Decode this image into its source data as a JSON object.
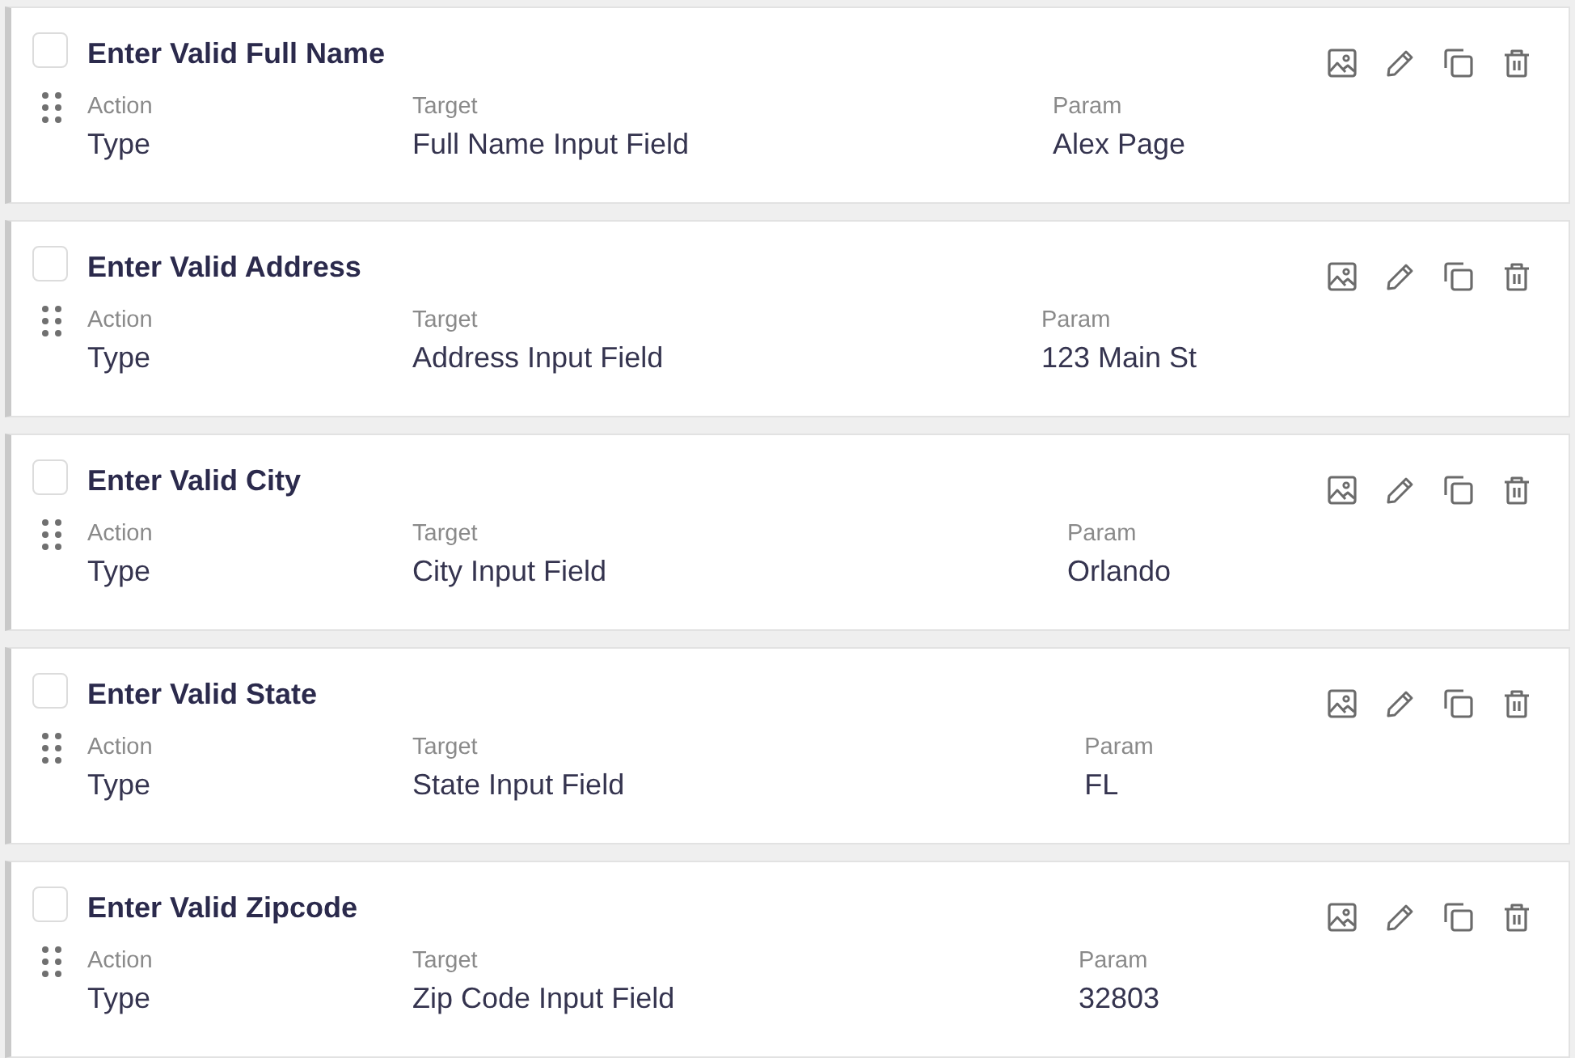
{
  "steps": [
    {
      "title": "Enter Valid Full Name",
      "checked": false,
      "fields": [
        {
          "label": "Action",
          "value": "Type"
        },
        {
          "label": "Target",
          "value": "Full Name Input Field"
        },
        {
          "label": "Param",
          "value": "Alex Page"
        }
      ]
    },
    {
      "title": "Enter Valid Address",
      "checked": false,
      "fields": [
        {
          "label": "Action",
          "value": "Type"
        },
        {
          "label": "Target",
          "value": "Address Input Field"
        },
        {
          "label": "Param",
          "value": "123 Main St"
        }
      ]
    },
    {
      "title": "Enter Valid City",
      "checked": false,
      "fields": [
        {
          "label": "Action",
          "value": "Type"
        },
        {
          "label": "Target",
          "value": "City Input Field"
        },
        {
          "label": "Param",
          "value": "Orlando"
        }
      ]
    },
    {
      "title": "Enter Valid State",
      "checked": false,
      "fields": [
        {
          "label": "Action",
          "value": "Type"
        },
        {
          "label": "Target",
          "value": "State Input Field"
        },
        {
          "label": "Param",
          "value": "FL"
        }
      ]
    },
    {
      "title": "Enter Valid Zipcode",
      "checked": false,
      "fields": [
        {
          "label": "Action",
          "value": "Type"
        },
        {
          "label": "Target",
          "value": "Zip Code Input Field"
        },
        {
          "label": "Param",
          "value": "32803"
        }
      ]
    }
  ]
}
